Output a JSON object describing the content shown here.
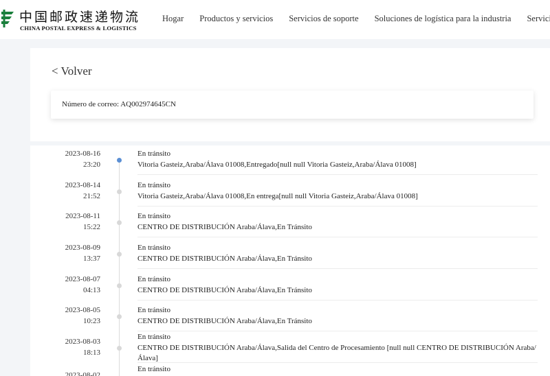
{
  "header": {
    "logo_cn": "中国邮政速递物流",
    "logo_en": "CHINA POSTAL EXPRESS & LOGISTICS",
    "nav": [
      "Hogar",
      "Productos y servicios",
      "Servicios de soporte",
      "Soluciones de logística para la industria",
      "Servicios de convenien"
    ]
  },
  "back_label": "< Volver",
  "tracking": {
    "label": "Número de correo: AQ002974645CN"
  },
  "events": [
    {
      "date": "2023-08-16",
      "time": "23:20",
      "status": "En tránsito",
      "description": "Vitoria Gasteiz,Araba/Álava 01008,Entregado[null null Vitoria Gasteiz,Araba/Álava 01008]"
    },
    {
      "date": "2023-08-14",
      "time": "21:52",
      "status": "En tránsito",
      "description": "Vitoria Gasteiz,Araba/Álava 01008,En entrega[null null Vitoria Gasteiz,Araba/Álava 01008]"
    },
    {
      "date": "2023-08-11",
      "time": "15:22",
      "status": "En tránsito",
      "description": "CENTRO DE DISTRIBUCIÓN Araba/Álava,En Tránsito"
    },
    {
      "date": "2023-08-09",
      "time": "13:37",
      "status": "En tránsito",
      "description": "CENTRO DE DISTRIBUCIÓN Araba/Álava,En Tránsito"
    },
    {
      "date": "2023-08-07",
      "time": "04:13",
      "status": "En tránsito",
      "description": "CENTRO DE DISTRIBUCIÓN Araba/Álava,En Tránsito"
    },
    {
      "date": "2023-08-05",
      "time": "10:23",
      "status": "En tránsito",
      "description": "CENTRO DE DISTRIBUCIÓN Araba/Álava,En Tránsito"
    },
    {
      "date": "2023-08-03",
      "time": "18:13",
      "status": "En tránsito",
      "description": "CENTRO DE DISTRIBUCIÓN Araba/Álava,Salida del Centro de Procesamiento [null null CENTRO DE DISTRIBUCIÓN Araba/Álava]"
    },
    {
      "date": "2023-08-02",
      "time": "",
      "status": "En tránsito",
      "description": ""
    }
  ],
  "colors": {
    "active_dot": "#5b8fd4",
    "logo_green": "#1a7f3c"
  }
}
